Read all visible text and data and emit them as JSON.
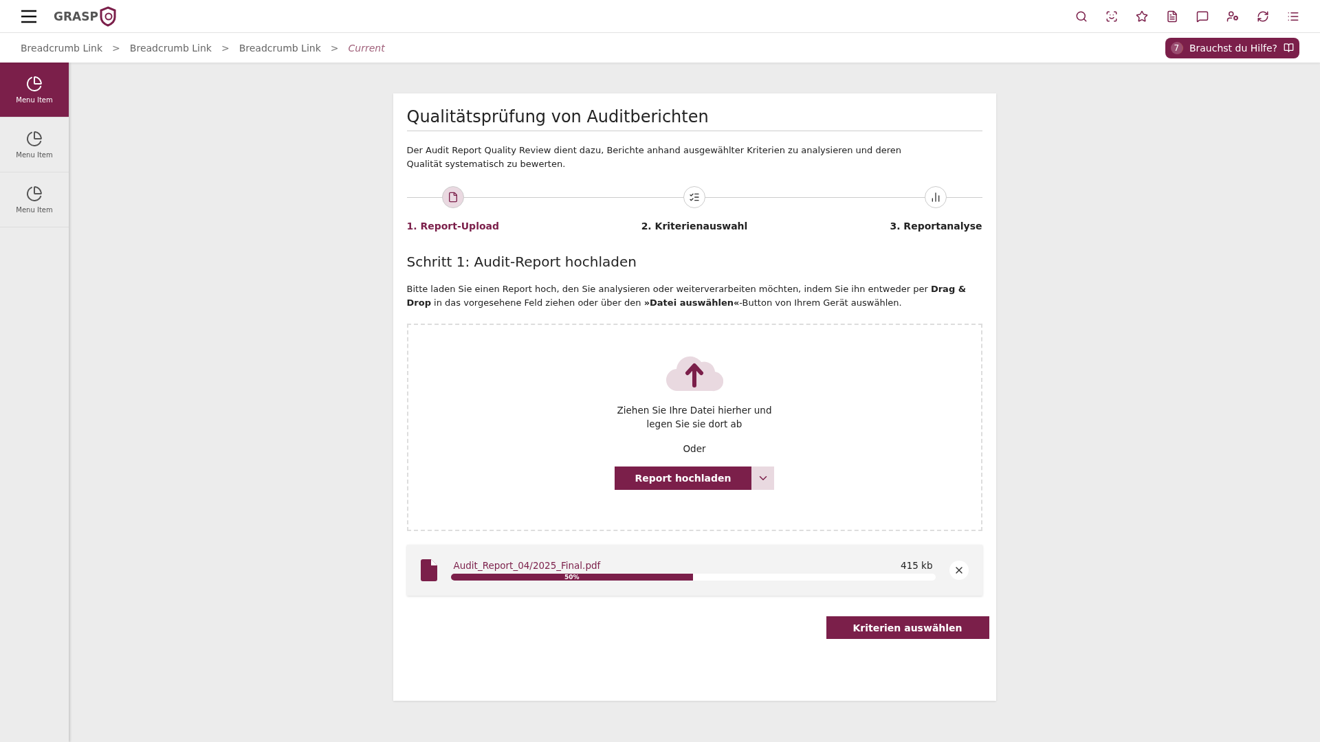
{
  "header": {
    "logo": "GRASP"
  },
  "breadcrumbs": [
    {
      "label": "Breadcrumb Link",
      "current": false
    },
    {
      "label": "Breadcrumb Link",
      "current": false
    },
    {
      "label": "Breadcrumb Link",
      "current": false
    },
    {
      "label": "Current",
      "current": true
    }
  ],
  "breadcrumb_separator": ">",
  "help_button": {
    "count": "7",
    "label": "Brauchst du Hilfe?"
  },
  "sidebar": {
    "items": [
      {
        "label": "Menu Item",
        "selected": true
      },
      {
        "label": "Menu Item",
        "selected": false
      },
      {
        "label": "Menu Item",
        "selected": false
      }
    ]
  },
  "card": {
    "title": "Qualitätsprüfung von Auditberichten",
    "intro": "Der Audit Report Quality Review dient dazu, Berichte anhand ausgewählter Kriterien zu analysieren und deren Qualität systematisch zu bewerten.",
    "steps": [
      {
        "label": "1. Report-Upload",
        "selected": true
      },
      {
        "label": "2. Kriterienauswahl",
        "selected": false
      },
      {
        "label": "3. Reportanalyse",
        "selected": false
      }
    ],
    "section_title": "Schritt 1: Audit-Report hochladen",
    "instructions": "Bitte laden Sie einen Report hoch, den Sie analysieren oder weiterverarbeiten möchten, indem Sie ihn entweder per **Drag & Drop** in das vorgesehene Feld ziehen oder über den **»Datei auswählen«**-Button von Ihrem Gerät auswählen.",
    "dropzone": {
      "text": "Ziehen Sie Ihre Datei hierher und legen Sie sie dort ab",
      "or": "Oder",
      "button": "Report hochladen"
    },
    "file": {
      "name": "Audit_Report_04/2025_Final.pdf",
      "size": "415 kb",
      "level": 0.5,
      "percent": "50%"
    },
    "next_button": "Kriterien auswählen"
  }
}
